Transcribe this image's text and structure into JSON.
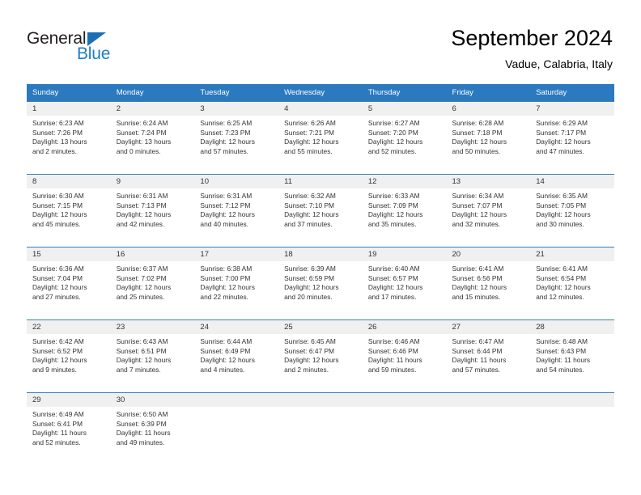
{
  "logo": {
    "word_one": "General",
    "word_two": "Blue",
    "triangle_color": "#1c6fb5",
    "blue_color": "#1c7fc4"
  },
  "header": {
    "title": "September 2024",
    "subtitle": "Vadue, Calabria, Italy"
  },
  "colors": {
    "header_row_bg": "#2b79bf",
    "header_row_text": "#ffffff",
    "cell_top_border": "#3b7fc0",
    "daynum_bg": "#f0f0f0",
    "body_text": "#333333"
  },
  "weekday_headers": [
    "Sunday",
    "Monday",
    "Tuesday",
    "Wednesday",
    "Thursday",
    "Friday",
    "Saturday"
  ],
  "weeks": [
    [
      {
        "day": "1",
        "sunrise": "Sunrise: 6:23 AM",
        "sunset": "Sunset: 7:26 PM",
        "daylight_line1": "Daylight: 13 hours",
        "daylight_line2": "and 2 minutes."
      },
      {
        "day": "2",
        "sunrise": "Sunrise: 6:24 AM",
        "sunset": "Sunset: 7:24 PM",
        "daylight_line1": "Daylight: 13 hours",
        "daylight_line2": "and 0 minutes."
      },
      {
        "day": "3",
        "sunrise": "Sunrise: 6:25 AM",
        "sunset": "Sunset: 7:23 PM",
        "daylight_line1": "Daylight: 12 hours",
        "daylight_line2": "and 57 minutes."
      },
      {
        "day": "4",
        "sunrise": "Sunrise: 6:26 AM",
        "sunset": "Sunset: 7:21 PM",
        "daylight_line1": "Daylight: 12 hours",
        "daylight_line2": "and 55 minutes."
      },
      {
        "day": "5",
        "sunrise": "Sunrise: 6:27 AM",
        "sunset": "Sunset: 7:20 PM",
        "daylight_line1": "Daylight: 12 hours",
        "daylight_line2": "and 52 minutes."
      },
      {
        "day": "6",
        "sunrise": "Sunrise: 6:28 AM",
        "sunset": "Sunset: 7:18 PM",
        "daylight_line1": "Daylight: 12 hours",
        "daylight_line2": "and 50 minutes."
      },
      {
        "day": "7",
        "sunrise": "Sunrise: 6:29 AM",
        "sunset": "Sunset: 7:17 PM",
        "daylight_line1": "Daylight: 12 hours",
        "daylight_line2": "and 47 minutes."
      }
    ],
    [
      {
        "day": "8",
        "sunrise": "Sunrise: 6:30 AM",
        "sunset": "Sunset: 7:15 PM",
        "daylight_line1": "Daylight: 12 hours",
        "daylight_line2": "and 45 minutes."
      },
      {
        "day": "9",
        "sunrise": "Sunrise: 6:31 AM",
        "sunset": "Sunset: 7:13 PM",
        "daylight_line1": "Daylight: 12 hours",
        "daylight_line2": "and 42 minutes."
      },
      {
        "day": "10",
        "sunrise": "Sunrise: 6:31 AM",
        "sunset": "Sunset: 7:12 PM",
        "daylight_line1": "Daylight: 12 hours",
        "daylight_line2": "and 40 minutes."
      },
      {
        "day": "11",
        "sunrise": "Sunrise: 6:32 AM",
        "sunset": "Sunset: 7:10 PM",
        "daylight_line1": "Daylight: 12 hours",
        "daylight_line2": "and 37 minutes."
      },
      {
        "day": "12",
        "sunrise": "Sunrise: 6:33 AM",
        "sunset": "Sunset: 7:09 PM",
        "daylight_line1": "Daylight: 12 hours",
        "daylight_line2": "and 35 minutes."
      },
      {
        "day": "13",
        "sunrise": "Sunrise: 6:34 AM",
        "sunset": "Sunset: 7:07 PM",
        "daylight_line1": "Daylight: 12 hours",
        "daylight_line2": "and 32 minutes."
      },
      {
        "day": "14",
        "sunrise": "Sunrise: 6:35 AM",
        "sunset": "Sunset: 7:05 PM",
        "daylight_line1": "Daylight: 12 hours",
        "daylight_line2": "and 30 minutes."
      }
    ],
    [
      {
        "day": "15",
        "sunrise": "Sunrise: 6:36 AM",
        "sunset": "Sunset: 7:04 PM",
        "daylight_line1": "Daylight: 12 hours",
        "daylight_line2": "and 27 minutes."
      },
      {
        "day": "16",
        "sunrise": "Sunrise: 6:37 AM",
        "sunset": "Sunset: 7:02 PM",
        "daylight_line1": "Daylight: 12 hours",
        "daylight_line2": "and 25 minutes."
      },
      {
        "day": "17",
        "sunrise": "Sunrise: 6:38 AM",
        "sunset": "Sunset: 7:00 PM",
        "daylight_line1": "Daylight: 12 hours",
        "daylight_line2": "and 22 minutes."
      },
      {
        "day": "18",
        "sunrise": "Sunrise: 6:39 AM",
        "sunset": "Sunset: 6:59 PM",
        "daylight_line1": "Daylight: 12 hours",
        "daylight_line2": "and 20 minutes."
      },
      {
        "day": "19",
        "sunrise": "Sunrise: 6:40 AM",
        "sunset": "Sunset: 6:57 PM",
        "daylight_line1": "Daylight: 12 hours",
        "daylight_line2": "and 17 minutes."
      },
      {
        "day": "20",
        "sunrise": "Sunrise: 6:41 AM",
        "sunset": "Sunset: 6:56 PM",
        "daylight_line1": "Daylight: 12 hours",
        "daylight_line2": "and 15 minutes."
      },
      {
        "day": "21",
        "sunrise": "Sunrise: 6:41 AM",
        "sunset": "Sunset: 6:54 PM",
        "daylight_line1": "Daylight: 12 hours",
        "daylight_line2": "and 12 minutes."
      }
    ],
    [
      {
        "day": "22",
        "sunrise": "Sunrise: 6:42 AM",
        "sunset": "Sunset: 6:52 PM",
        "daylight_line1": "Daylight: 12 hours",
        "daylight_line2": "and 9 minutes."
      },
      {
        "day": "23",
        "sunrise": "Sunrise: 6:43 AM",
        "sunset": "Sunset: 6:51 PM",
        "daylight_line1": "Daylight: 12 hours",
        "daylight_line2": "and 7 minutes."
      },
      {
        "day": "24",
        "sunrise": "Sunrise: 6:44 AM",
        "sunset": "Sunset: 6:49 PM",
        "daylight_line1": "Daylight: 12 hours",
        "daylight_line2": "and 4 minutes."
      },
      {
        "day": "25",
        "sunrise": "Sunrise: 6:45 AM",
        "sunset": "Sunset: 6:47 PM",
        "daylight_line1": "Daylight: 12 hours",
        "daylight_line2": "and 2 minutes."
      },
      {
        "day": "26",
        "sunrise": "Sunrise: 6:46 AM",
        "sunset": "Sunset: 6:46 PM",
        "daylight_line1": "Daylight: 11 hours",
        "daylight_line2": "and 59 minutes."
      },
      {
        "day": "27",
        "sunrise": "Sunrise: 6:47 AM",
        "sunset": "Sunset: 6:44 PM",
        "daylight_line1": "Daylight: 11 hours",
        "daylight_line2": "and 57 minutes."
      },
      {
        "day": "28",
        "sunrise": "Sunrise: 6:48 AM",
        "sunset": "Sunset: 6:43 PM",
        "daylight_line1": "Daylight: 11 hours",
        "daylight_line2": "and 54 minutes."
      }
    ],
    [
      {
        "day": "29",
        "sunrise": "Sunrise: 6:49 AM",
        "sunset": "Sunset: 6:41 PM",
        "daylight_line1": "Daylight: 11 hours",
        "daylight_line2": "and 52 minutes."
      },
      {
        "day": "30",
        "sunrise": "Sunrise: 6:50 AM",
        "sunset": "Sunset: 6:39 PM",
        "daylight_line1": "Daylight: 11 hours",
        "daylight_line2": "and 49 minutes."
      },
      {
        "day": "",
        "sunrise": "",
        "sunset": "",
        "daylight_line1": "",
        "daylight_line2": ""
      },
      {
        "day": "",
        "sunrise": "",
        "sunset": "",
        "daylight_line1": "",
        "daylight_line2": ""
      },
      {
        "day": "",
        "sunrise": "",
        "sunset": "",
        "daylight_line1": "",
        "daylight_line2": ""
      },
      {
        "day": "",
        "sunrise": "",
        "sunset": "",
        "daylight_line1": "",
        "daylight_line2": ""
      },
      {
        "day": "",
        "sunrise": "",
        "sunset": "",
        "daylight_line1": "",
        "daylight_line2": ""
      }
    ]
  ]
}
